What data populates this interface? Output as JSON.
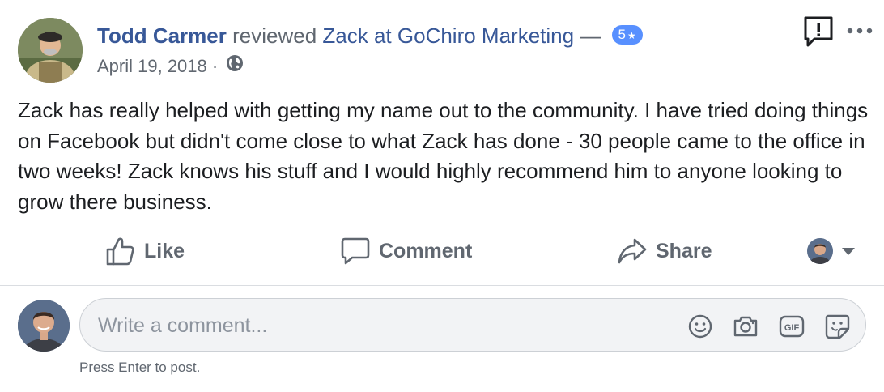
{
  "post": {
    "reviewer": "Todd Carmer",
    "reviewed_word": "reviewed",
    "page_name": "Zack at GoChiro Marketing",
    "dash": "—",
    "rating": "5",
    "rating_star": "★",
    "date": "April 19, 2018",
    "date_sep": "·",
    "privacy_icon": "globe-icon",
    "body": "Zack has really helped with getting my name out to the community. I have tried doing things on Facebook but didn't come close to what Zack has done - 30 people came to the office in two weeks! Zack knows his stuff and I would highly recommend him to anyone looking to grow there business."
  },
  "actions": {
    "like": "Like",
    "comment": "Comment",
    "share": "Share"
  },
  "composer": {
    "placeholder": "Write a comment...",
    "hint": "Press Enter to post.",
    "icons": [
      "emoji-icon",
      "camera-icon",
      "gif-icon",
      "sticker-icon"
    ]
  },
  "colors": {
    "link": "#385898",
    "secondary": "#606770",
    "rating_badge": "#5890ff",
    "input_bg": "#f2f3f5"
  }
}
